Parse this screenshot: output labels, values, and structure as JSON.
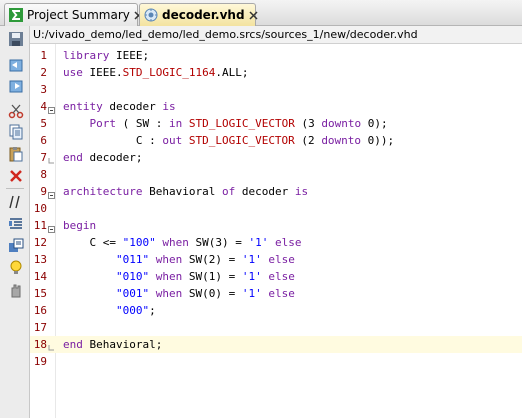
{
  "tabs": [
    {
      "label": "Project Summary",
      "icon": "sigma-icon",
      "active": false
    },
    {
      "label": "decoder.vhd",
      "icon": "vhdl-file-icon",
      "active": true
    }
  ],
  "path": "U:/vivado_demo/led_demo/led_demo.srcs/sources_1/new/decoder.vhd",
  "toolbar": [
    "save-icon",
    "undo-icon",
    "redo-icon",
    "cut-icon",
    "copy-icon",
    "paste-icon",
    "delete-icon",
    "comment-icon",
    "indent-icon",
    "language-templates-icon",
    "insert-template-icon",
    "bulb-icon",
    "hand-icon"
  ],
  "current_line": 18,
  "code_lines": [
    {
      "n": "1",
      "text": "library IEEE;"
    },
    {
      "n": "2",
      "text": "use IEEE.STD_LOGIC_1164.ALL;"
    },
    {
      "n": "3",
      "text": ""
    },
    {
      "n": "4",
      "text": "entity decoder is"
    },
    {
      "n": "5",
      "text": "    Port ( SW : in STD_LOGIC_VECTOR (3 downto 0);"
    },
    {
      "n": "6",
      "text": "           C : out STD_LOGIC_VECTOR (2 downto 0));"
    },
    {
      "n": "7",
      "text": "end decoder;"
    },
    {
      "n": "8",
      "text": ""
    },
    {
      "n": "9",
      "text": "architecture Behavioral of decoder is"
    },
    {
      "n": "10",
      "text": ""
    },
    {
      "n": "11",
      "text": "begin"
    },
    {
      "n": "12",
      "text": "    C <= \"100\" when SW(3) = '1' else"
    },
    {
      "n": "13",
      "text": "        \"011\" when SW(2) = '1' else"
    },
    {
      "n": "14",
      "text": "        \"010\" when SW(1) = '1' else"
    },
    {
      "n": "15",
      "text": "        \"001\" when SW(0) = '1' else"
    },
    {
      "n": "16",
      "text": "        \"000\";"
    },
    {
      "n": "17",
      "text": ""
    },
    {
      "n": "18",
      "text": "end Behavioral;"
    },
    {
      "n": "19",
      "text": ""
    }
  ]
}
